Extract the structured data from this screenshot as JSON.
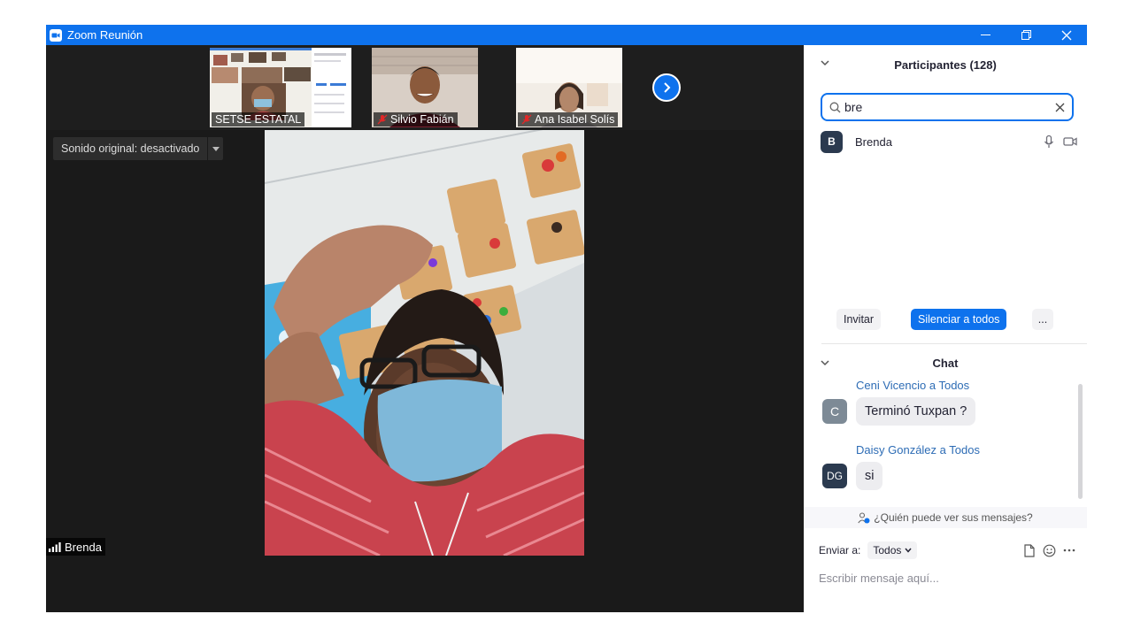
{
  "window": {
    "title": "Zoom Reunión"
  },
  "thumbnails": [
    {
      "name": "SETSE ESTATAL",
      "muted": false
    },
    {
      "name": "Silvio Fabián",
      "muted": true
    },
    {
      "name": "Ana  Isabel Solís",
      "muted": true
    }
  ],
  "main_video": {
    "sound_label": "Sonido original: desactivado",
    "speaker_name": "Brenda"
  },
  "participants": {
    "title": "Participantes (128)",
    "search_value": "bre",
    "items": [
      {
        "initial": "B",
        "name": "Brenda"
      }
    ],
    "invite_label": "Invitar",
    "mute_all_label": "Silenciar a todos",
    "more_label": "..."
  },
  "chat": {
    "title": "Chat",
    "messages": [
      {
        "sender": "Ceni Vicencio a Todos",
        "initials": "C",
        "text": "Terminó Tuxpan ?"
      },
      {
        "sender": "Daisy González a Todos",
        "initials": "DG",
        "text": "si"
      }
    ],
    "who_sees": "¿Quién puede ver sus mensajes?",
    "send_to_label": "Enviar a:",
    "send_to_value": "Todos",
    "input_placeholder": "Escribir mensaje aquí..."
  },
  "colors": {
    "zoom_blue": "#0e72ed",
    "avatar_c": "#7d8a96",
    "avatar_dg": "#2b3a4f",
    "link_blue": "#2d6cb5"
  }
}
